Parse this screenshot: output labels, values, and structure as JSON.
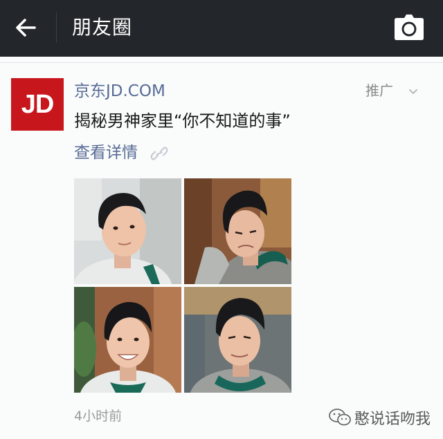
{
  "header": {
    "title": "朋友圈"
  },
  "post": {
    "avatar_text": "JD",
    "author": "京东JD.COM",
    "promo_label": "推广",
    "content": "揭秘男神家里“你不知道的事”",
    "detail_link": "查看详情",
    "time": "4小时前",
    "image_count": 4
  },
  "watermark": {
    "text": "憨说话吻我"
  },
  "colors": {
    "topbar": "#23272b",
    "link_blue": "#576b95",
    "jd_red": "#c8161d",
    "background": "#fafbfb"
  },
  "icons": [
    "back-arrow-icon",
    "camera-icon",
    "chevron-down-icon",
    "link-icon",
    "wechat-icon"
  ]
}
